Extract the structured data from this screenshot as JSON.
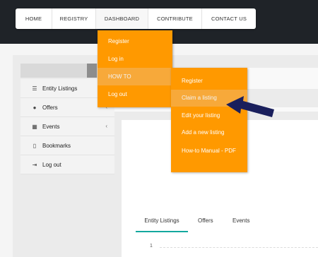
{
  "nav": {
    "items": [
      {
        "label": "HOME"
      },
      {
        "label": "REGISTRY"
      },
      {
        "label": "DASHBOARD"
      },
      {
        "label": "CONTRIBUTE"
      },
      {
        "label": "CONTACT US"
      }
    ]
  },
  "dashboard_menu": {
    "items": [
      {
        "label": "Register"
      },
      {
        "label": "Log in"
      },
      {
        "label": "HOW TO"
      },
      {
        "label": "Log out"
      }
    ]
  },
  "howto_menu": {
    "items": [
      {
        "label": "Register"
      },
      {
        "label": "Claim a listing"
      },
      {
        "label": "Edit your listing"
      },
      {
        "label": "Add a new listing"
      },
      {
        "label": "How-to Manual - PDF"
      }
    ]
  },
  "sidebar": {
    "items": [
      {
        "label": "Entity Listings",
        "icon": "list-icon"
      },
      {
        "label": "Offers",
        "icon": "circle-icon"
      },
      {
        "label": "Events",
        "icon": "calendar-icon"
      },
      {
        "label": "Bookmarks",
        "icon": "bookmark-icon"
      },
      {
        "label": "Log out",
        "icon": "sign-out-icon"
      }
    ]
  },
  "tabs": [
    {
      "label": "Entity Listings"
    },
    {
      "label": "Offers"
    },
    {
      "label": "Events"
    }
  ],
  "chart": {
    "first_tick": "1"
  },
  "colors": {
    "menu_bg": "#ff9900",
    "menu_hover": "#f7a93a",
    "topbar": "#1f2328",
    "tab_active": "#13a89e",
    "arrow": "#1a1f5c"
  }
}
